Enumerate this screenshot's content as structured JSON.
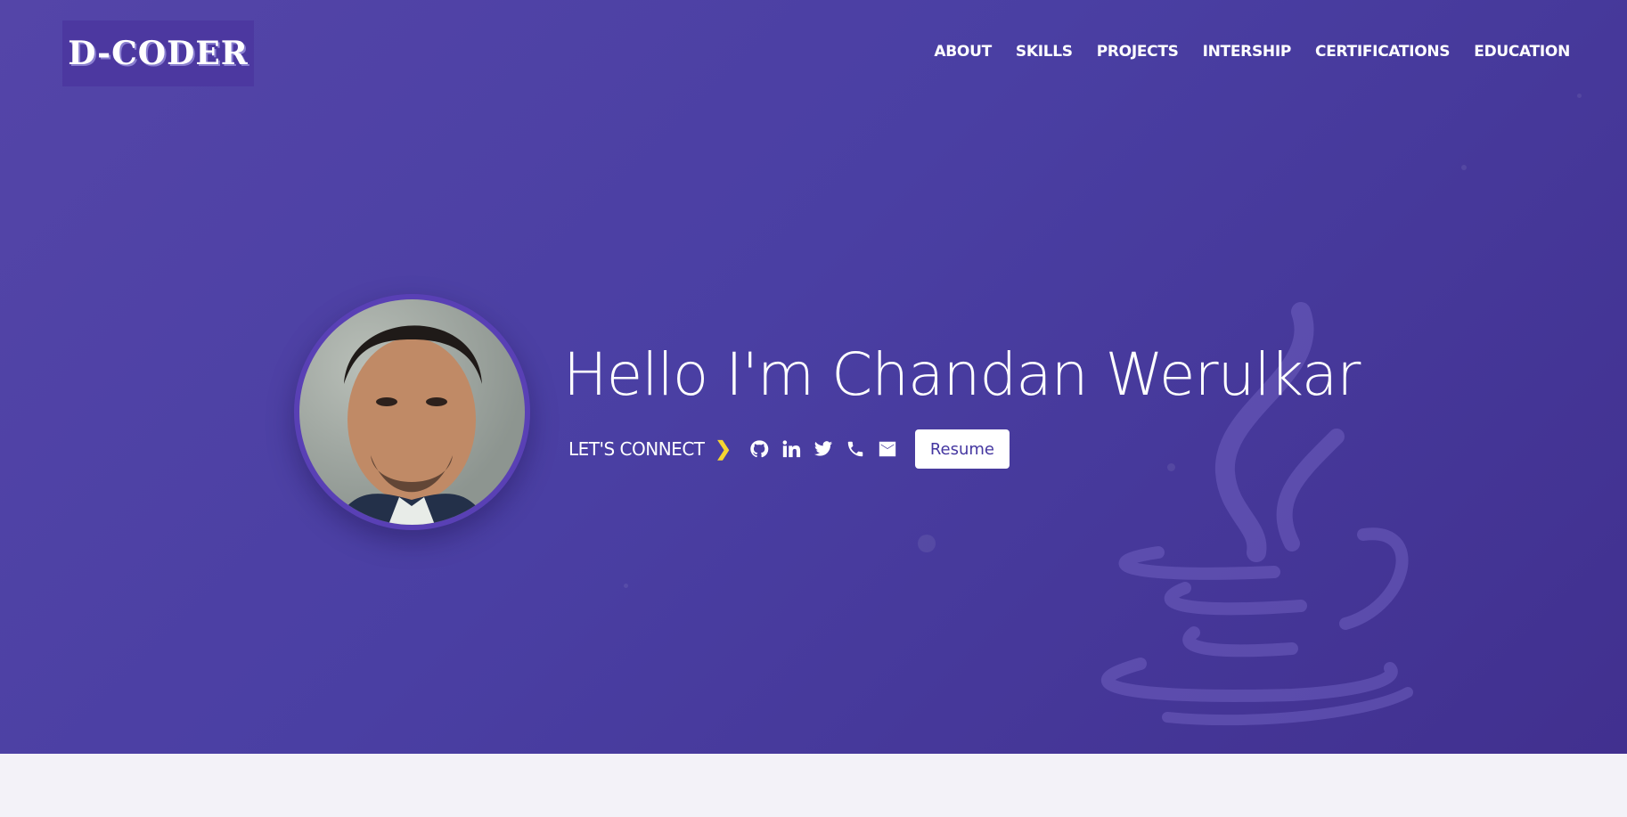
{
  "header": {
    "logo_text": "D-CODER",
    "nav": [
      {
        "label": "ABOUT"
      },
      {
        "label": "SKILLS"
      },
      {
        "label": "PROJECTS"
      },
      {
        "label": "INTERSHIP"
      },
      {
        "label": "CERTIFICATIONS"
      },
      {
        "label": "EDUCATION"
      }
    ]
  },
  "hero": {
    "headline": "Hello I'm Chandan Werulkar",
    "connect_label": "LET'S CONNECT",
    "connect_icon": "chevron-right-icon",
    "social_icons": [
      "github-icon",
      "linkedin-icon",
      "twitter-icon",
      "phone-icon",
      "mail-icon"
    ],
    "resume_label": "Resume",
    "background_icon": "java-logo-icon",
    "avatar_alt": "profile-photo"
  },
  "colors": {
    "hero_bg": "#4a3fa3",
    "accent_chevron": "#f5d531",
    "button_text": "#4436a0",
    "page_bg": "#f3f2f8"
  }
}
